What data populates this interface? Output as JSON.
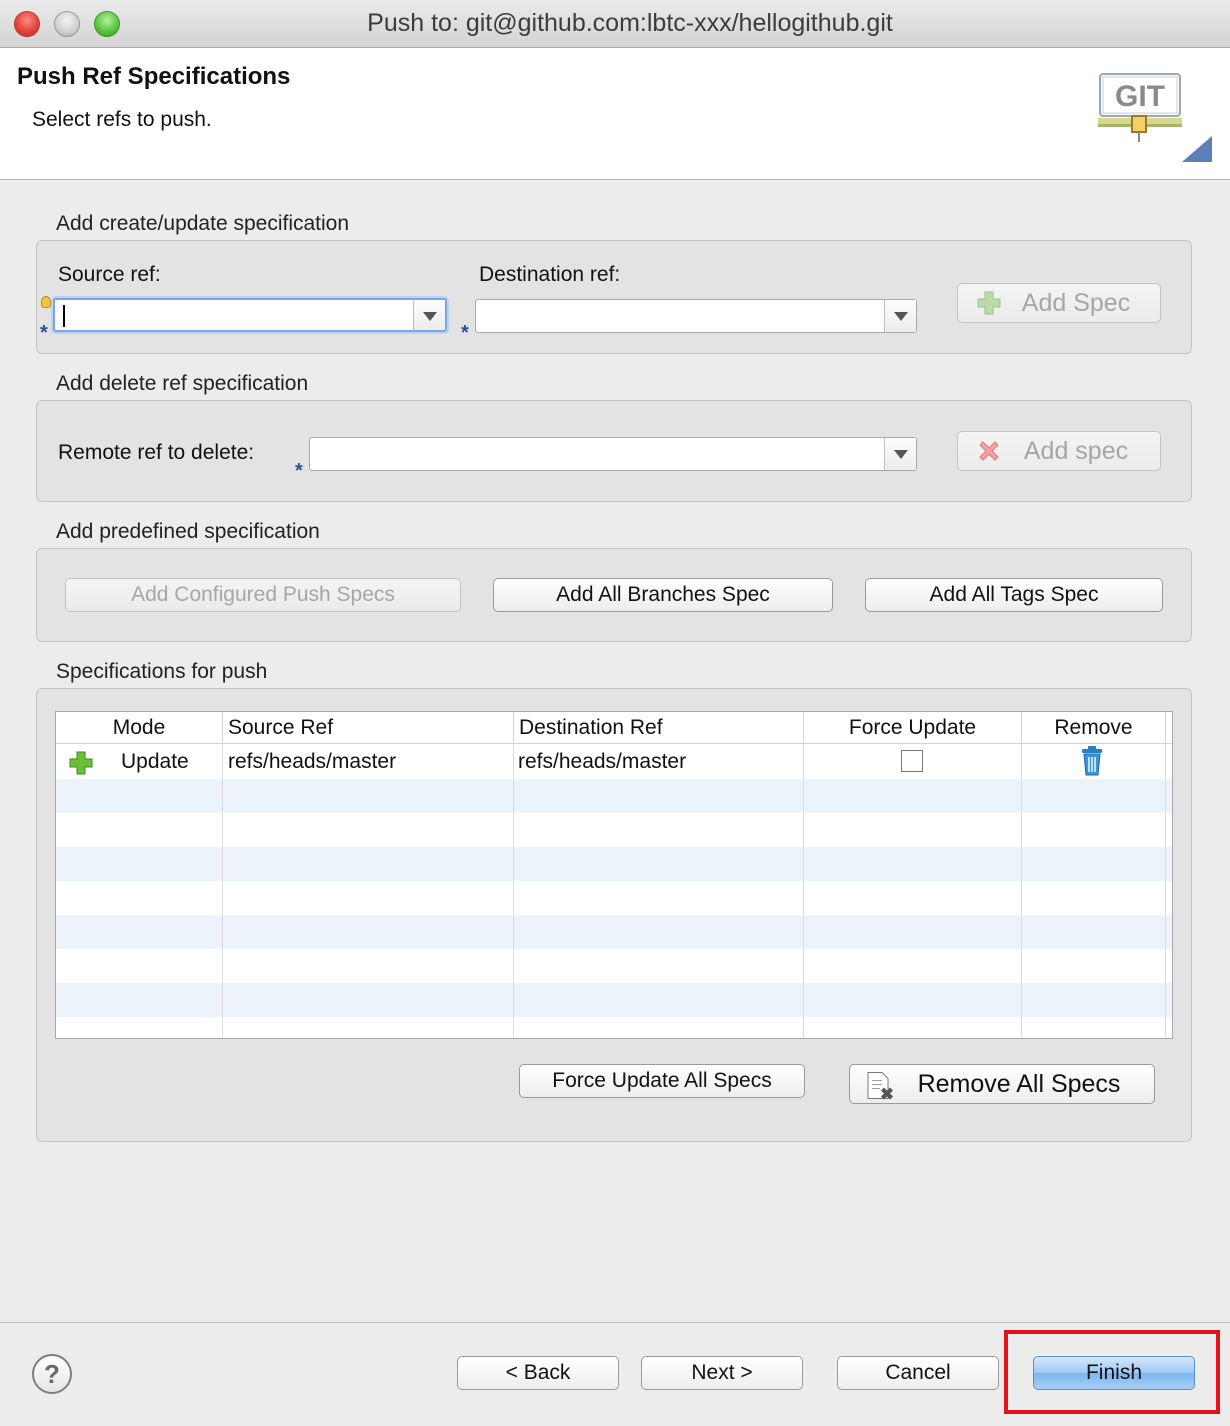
{
  "window": {
    "title": "Push to: git@github.com:lbtc-xxx/hellogithub.git"
  },
  "header": {
    "title": "Push Ref Specifications",
    "subtitle": "Select refs to push.",
    "logo_text": "GIT"
  },
  "create_update": {
    "group_label": "Add create/update specification",
    "source_label": "Source ref:",
    "source_value": "",
    "destination_label": "Destination ref:",
    "destination_value": "",
    "add_button": "Add Spec",
    "required_marker": "*"
  },
  "delete_ref": {
    "group_label": "Add delete ref specification",
    "remote_label": "Remote ref to delete:",
    "remote_value": "",
    "add_button": "Add spec",
    "required_marker": "*"
  },
  "predefined": {
    "group_label": "Add predefined specification",
    "configured_button": "Add Configured Push Specs",
    "branches_button": "Add All Branches Spec",
    "tags_button": "Add All Tags Spec"
  },
  "specs": {
    "group_label": "Specifications for push",
    "columns": [
      "Mode",
      "Source Ref",
      "Destination Ref",
      "Force Update",
      "Remove"
    ],
    "rows": [
      {
        "mode": "Update",
        "source": "refs/heads/master",
        "destination": "refs/heads/master",
        "force_update": false
      }
    ],
    "force_all_button": "Force Update All Specs",
    "remove_all_button": "Remove All Specs"
  },
  "footer": {
    "help_label": "?",
    "back_button": "< Back",
    "next_button": "Next >",
    "cancel_button": "Cancel",
    "finish_button": "Finish"
  },
  "colors": {
    "highlight": "#e3121a",
    "default_button": "#9cc8f5",
    "required_marker": "#2b4f9b"
  }
}
